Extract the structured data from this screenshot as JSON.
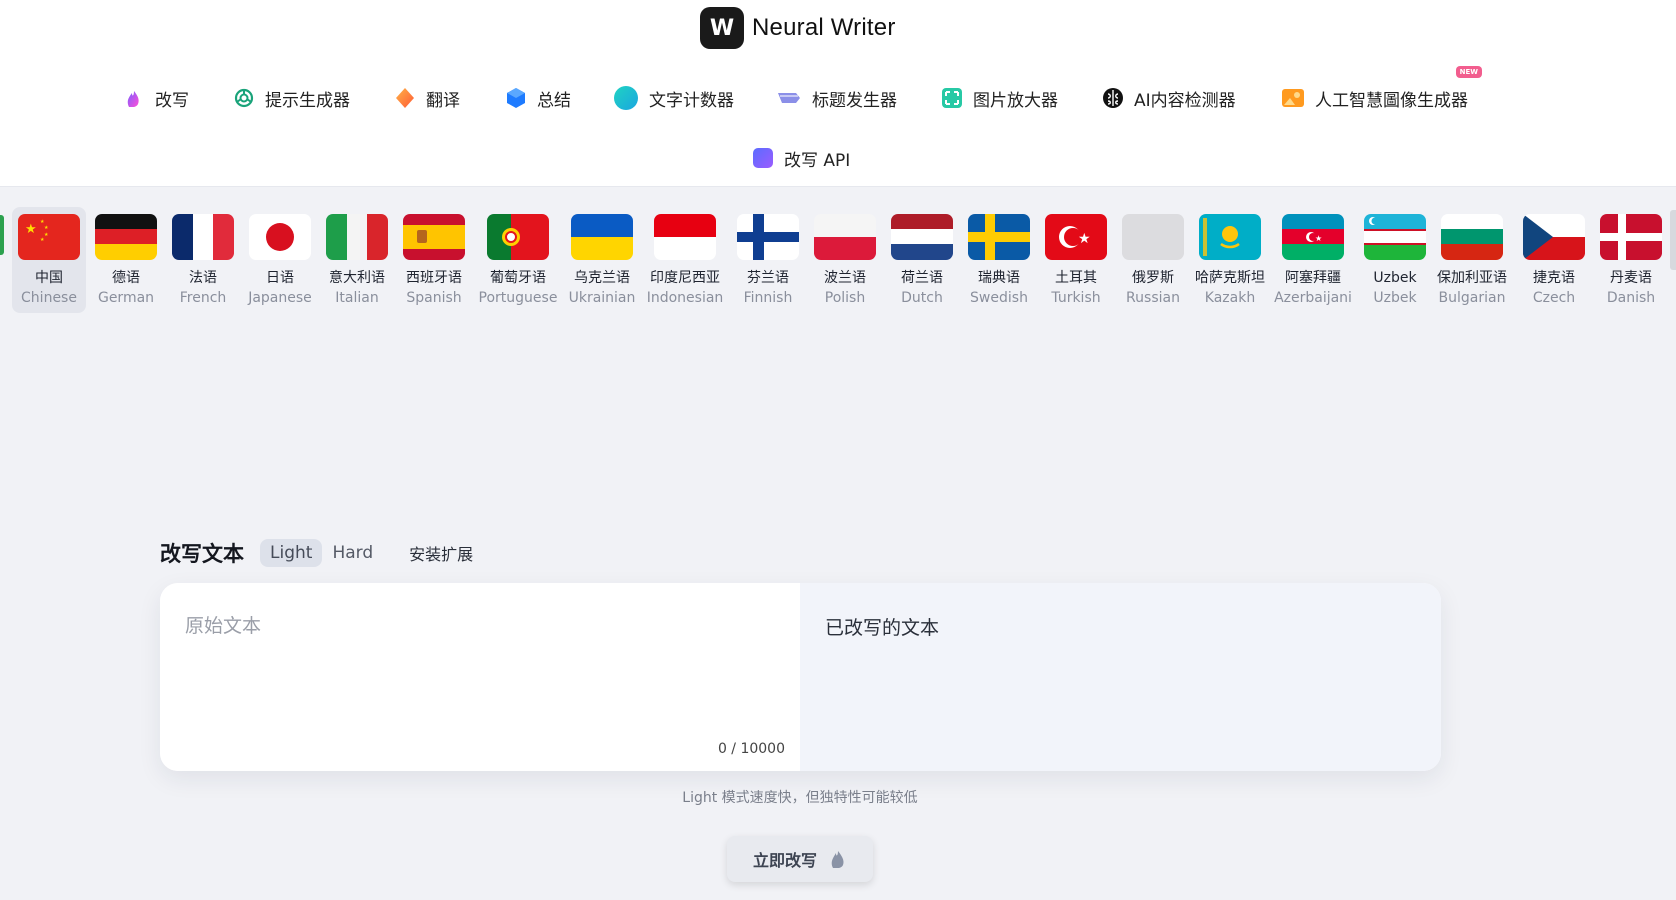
{
  "brand": {
    "name": "Neural Writer",
    "mark": "W"
  },
  "nav": {
    "items": [
      {
        "label": "改写",
        "icon": "rewrite-flame-icon"
      },
      {
        "label": "提示生成器",
        "icon": "openai-knot-icon"
      },
      {
        "label": "翻译",
        "icon": "diamond-icon"
      },
      {
        "label": "总结",
        "icon": "cube-icon"
      },
      {
        "label": "文字计数器",
        "icon": "circle-icon"
      },
      {
        "label": "标题发生器",
        "icon": "tag-icon"
      },
      {
        "label": "图片放大器",
        "icon": "image-upscale-icon"
      },
      {
        "label": "AI内容检测器",
        "icon": "brain-icon"
      },
      {
        "label": "人工智慧圖像生成器",
        "icon": "image-generator-icon",
        "badge": "NEW"
      }
    ],
    "api": {
      "label": "改写 API",
      "icon": "api-square-icon"
    }
  },
  "languages": [
    {
      "zh": "中国",
      "en": "Chinese",
      "active": true
    },
    {
      "zh": "德语",
      "en": "German"
    },
    {
      "zh": "法语",
      "en": "French"
    },
    {
      "zh": "日语",
      "en": "Japanese"
    },
    {
      "zh": "意大利语",
      "en": "Italian"
    },
    {
      "zh": "西班牙语",
      "en": "Spanish"
    },
    {
      "zh": "葡萄牙语",
      "en": "Portuguese"
    },
    {
      "zh": "乌克兰语",
      "en": "Ukrainian"
    },
    {
      "zh": "印度尼西亚",
      "en": "Indonesian"
    },
    {
      "zh": "芬兰语",
      "en": "Finnish"
    },
    {
      "zh": "波兰语",
      "en": "Polish"
    },
    {
      "zh": "荷兰语",
      "en": "Dutch"
    },
    {
      "zh": "瑞典语",
      "en": "Swedish"
    },
    {
      "zh": "土耳其",
      "en": "Turkish"
    },
    {
      "zh": "俄罗斯",
      "en": "Russian"
    },
    {
      "zh": "哈萨克斯坦",
      "en": "Kazakh"
    },
    {
      "zh": "阿塞拜疆",
      "en": "Azerbaijani"
    },
    {
      "zh": "Uzbek",
      "en": "Uzbek"
    },
    {
      "zh": "保加利亚语",
      "en": "Bulgarian"
    },
    {
      "zh": "捷克语",
      "en": "Czech"
    },
    {
      "zh": "丹麦语",
      "en": "Danish"
    }
  ],
  "editor": {
    "title": "改写文本",
    "modes": [
      "Light",
      "Hard"
    ],
    "active_mode": "Light",
    "extension_label": "安装扩展",
    "input_placeholder": "原始文本",
    "input_value": "",
    "counter": "0 / 10000",
    "output_placeholder": "已改写的文本",
    "hint": "Light 模式速度快，但独特性可能较低",
    "submit_label": "立即改写"
  },
  "colors": {
    "accent": "#7c5cff",
    "new_badge": "#f25d8e",
    "page_bg": "#f1f2f6"
  }
}
